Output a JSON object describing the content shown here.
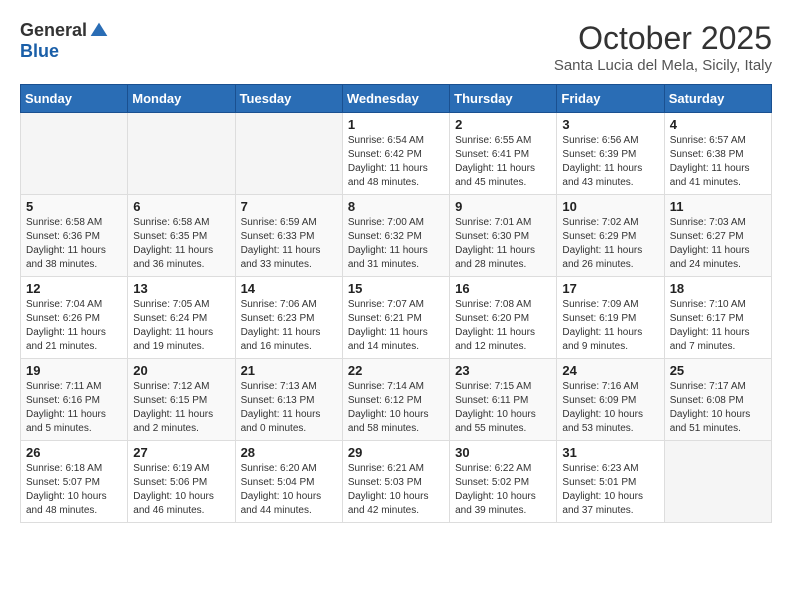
{
  "header": {
    "logo_general": "General",
    "logo_blue": "Blue",
    "month_title": "October 2025",
    "subtitle": "Santa Lucia del Mela, Sicily, Italy"
  },
  "days_of_week": [
    "Sunday",
    "Monday",
    "Tuesday",
    "Wednesday",
    "Thursday",
    "Friday",
    "Saturday"
  ],
  "weeks": [
    [
      {
        "day": "",
        "info": ""
      },
      {
        "day": "",
        "info": ""
      },
      {
        "day": "",
        "info": ""
      },
      {
        "day": "1",
        "info": "Sunrise: 6:54 AM\nSunset: 6:42 PM\nDaylight: 11 hours\nand 48 minutes."
      },
      {
        "day": "2",
        "info": "Sunrise: 6:55 AM\nSunset: 6:41 PM\nDaylight: 11 hours\nand 45 minutes."
      },
      {
        "day": "3",
        "info": "Sunrise: 6:56 AM\nSunset: 6:39 PM\nDaylight: 11 hours\nand 43 minutes."
      },
      {
        "day": "4",
        "info": "Sunrise: 6:57 AM\nSunset: 6:38 PM\nDaylight: 11 hours\nand 41 minutes."
      }
    ],
    [
      {
        "day": "5",
        "info": "Sunrise: 6:58 AM\nSunset: 6:36 PM\nDaylight: 11 hours\nand 38 minutes."
      },
      {
        "day": "6",
        "info": "Sunrise: 6:58 AM\nSunset: 6:35 PM\nDaylight: 11 hours\nand 36 minutes."
      },
      {
        "day": "7",
        "info": "Sunrise: 6:59 AM\nSunset: 6:33 PM\nDaylight: 11 hours\nand 33 minutes."
      },
      {
        "day": "8",
        "info": "Sunrise: 7:00 AM\nSunset: 6:32 PM\nDaylight: 11 hours\nand 31 minutes."
      },
      {
        "day": "9",
        "info": "Sunrise: 7:01 AM\nSunset: 6:30 PM\nDaylight: 11 hours\nand 28 minutes."
      },
      {
        "day": "10",
        "info": "Sunrise: 7:02 AM\nSunset: 6:29 PM\nDaylight: 11 hours\nand 26 minutes."
      },
      {
        "day": "11",
        "info": "Sunrise: 7:03 AM\nSunset: 6:27 PM\nDaylight: 11 hours\nand 24 minutes."
      }
    ],
    [
      {
        "day": "12",
        "info": "Sunrise: 7:04 AM\nSunset: 6:26 PM\nDaylight: 11 hours\nand 21 minutes."
      },
      {
        "day": "13",
        "info": "Sunrise: 7:05 AM\nSunset: 6:24 PM\nDaylight: 11 hours\nand 19 minutes."
      },
      {
        "day": "14",
        "info": "Sunrise: 7:06 AM\nSunset: 6:23 PM\nDaylight: 11 hours\nand 16 minutes."
      },
      {
        "day": "15",
        "info": "Sunrise: 7:07 AM\nSunset: 6:21 PM\nDaylight: 11 hours\nand 14 minutes."
      },
      {
        "day": "16",
        "info": "Sunrise: 7:08 AM\nSunset: 6:20 PM\nDaylight: 11 hours\nand 12 minutes."
      },
      {
        "day": "17",
        "info": "Sunrise: 7:09 AM\nSunset: 6:19 PM\nDaylight: 11 hours\nand 9 minutes."
      },
      {
        "day": "18",
        "info": "Sunrise: 7:10 AM\nSunset: 6:17 PM\nDaylight: 11 hours\nand 7 minutes."
      }
    ],
    [
      {
        "day": "19",
        "info": "Sunrise: 7:11 AM\nSunset: 6:16 PM\nDaylight: 11 hours\nand 5 minutes."
      },
      {
        "day": "20",
        "info": "Sunrise: 7:12 AM\nSunset: 6:15 PM\nDaylight: 11 hours\nand 2 minutes."
      },
      {
        "day": "21",
        "info": "Sunrise: 7:13 AM\nSunset: 6:13 PM\nDaylight: 11 hours\nand 0 minutes."
      },
      {
        "day": "22",
        "info": "Sunrise: 7:14 AM\nSunset: 6:12 PM\nDaylight: 10 hours\nand 58 minutes."
      },
      {
        "day": "23",
        "info": "Sunrise: 7:15 AM\nSunset: 6:11 PM\nDaylight: 10 hours\nand 55 minutes."
      },
      {
        "day": "24",
        "info": "Sunrise: 7:16 AM\nSunset: 6:09 PM\nDaylight: 10 hours\nand 53 minutes."
      },
      {
        "day": "25",
        "info": "Sunrise: 7:17 AM\nSunset: 6:08 PM\nDaylight: 10 hours\nand 51 minutes."
      }
    ],
    [
      {
        "day": "26",
        "info": "Sunrise: 6:18 AM\nSunset: 5:07 PM\nDaylight: 10 hours\nand 48 minutes."
      },
      {
        "day": "27",
        "info": "Sunrise: 6:19 AM\nSunset: 5:06 PM\nDaylight: 10 hours\nand 46 minutes."
      },
      {
        "day": "28",
        "info": "Sunrise: 6:20 AM\nSunset: 5:04 PM\nDaylight: 10 hours\nand 44 minutes."
      },
      {
        "day": "29",
        "info": "Sunrise: 6:21 AM\nSunset: 5:03 PM\nDaylight: 10 hours\nand 42 minutes."
      },
      {
        "day": "30",
        "info": "Sunrise: 6:22 AM\nSunset: 5:02 PM\nDaylight: 10 hours\nand 39 minutes."
      },
      {
        "day": "31",
        "info": "Sunrise: 6:23 AM\nSunset: 5:01 PM\nDaylight: 10 hours\nand 37 minutes."
      },
      {
        "day": "",
        "info": ""
      }
    ]
  ]
}
